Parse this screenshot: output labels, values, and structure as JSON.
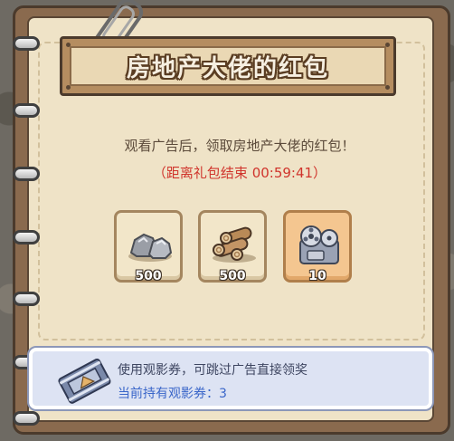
{
  "dialog": {
    "title": "房地产大佬的红包",
    "description": "观看广告后，领取房地产大佬的红包！",
    "timer_text": "（距离礼包结束 00:59:41）"
  },
  "rewards": [
    {
      "icon": "stone-icon",
      "quantity": "500"
    },
    {
      "icon": "wood-logs-icon",
      "quantity": "500"
    },
    {
      "icon": "film-reel-icon",
      "quantity": "10"
    }
  ],
  "ticket": {
    "icon": "film-ticket-icon",
    "text": "使用观影券，可跳过广告直接领奖",
    "held_text": "当前持有观影券：3"
  },
  "colors": {
    "timer": "#d0342c",
    "ticket_count": "#3a66c9",
    "highlight_slot": "#f4c690"
  }
}
